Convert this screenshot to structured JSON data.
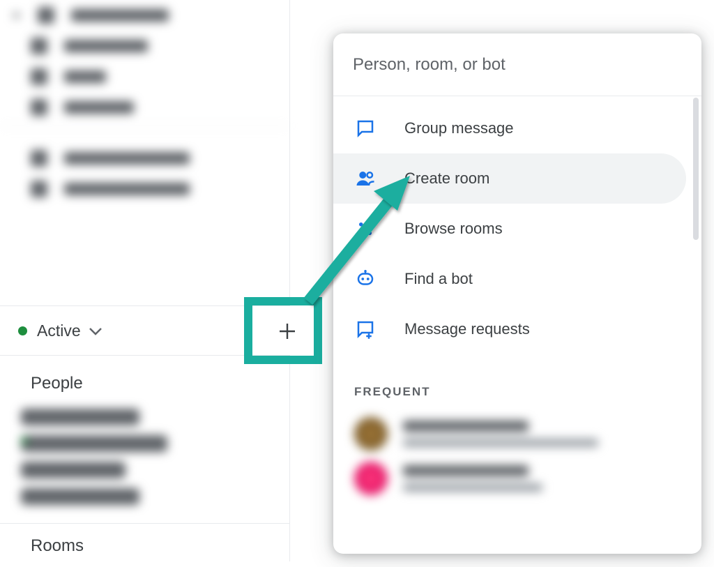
{
  "sidebar": {
    "status_label": "Active",
    "people_header": "People",
    "rooms_header": "Rooms"
  },
  "popup": {
    "search_placeholder": "Person, room, or bot",
    "menu": {
      "group_message": "Group message",
      "create_room": "Create room",
      "browse_rooms": "Browse rooms",
      "find_bot": "Find a bot",
      "message_requests": "Message requests"
    },
    "frequent_label": "FREQUENT"
  },
  "colors": {
    "icon_blue": "#1a73e8",
    "highlight_teal": "#1aae9f",
    "presence_green": "#1e8e3e"
  }
}
